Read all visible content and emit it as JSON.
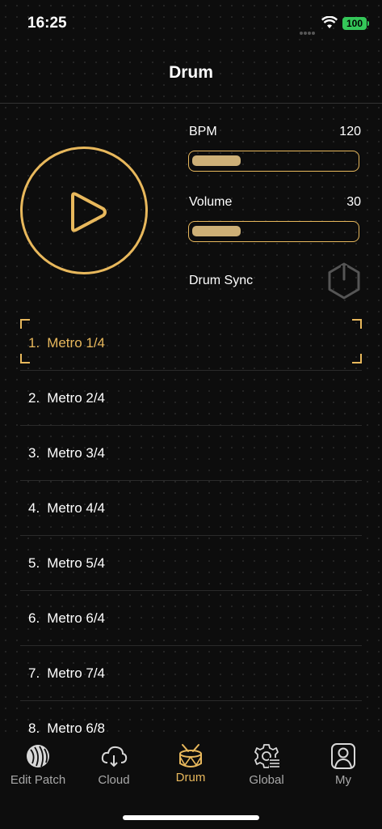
{
  "status": {
    "time": "16:25",
    "battery": "100"
  },
  "nav": {
    "title": "Drum"
  },
  "controls": {
    "bpm_label": "BPM",
    "bpm_value": "120",
    "bpm_fraction": 0.3,
    "volume_label": "Volume",
    "volume_value": "30",
    "volume_fraction": 0.3,
    "sync_label": "Drum Sync"
  },
  "patterns": [
    {
      "number": "1.",
      "name": "Metro 1/4",
      "selected": true
    },
    {
      "number": "2.",
      "name": "Metro 2/4",
      "selected": false
    },
    {
      "number": "3.",
      "name": "Metro 3/4",
      "selected": false
    },
    {
      "number": "4.",
      "name": "Metro 4/4",
      "selected": false
    },
    {
      "number": "5.",
      "name": "Metro 5/4",
      "selected": false
    },
    {
      "number": "6.",
      "name": "Metro 6/4",
      "selected": false
    },
    {
      "number": "7.",
      "name": "Metro 7/4",
      "selected": false
    },
    {
      "number": "8.",
      "name": "Metro 6/8",
      "selected": false
    }
  ],
  "tabs": [
    {
      "label": "Edit Patch",
      "icon": "edit-patch-icon",
      "active": false
    },
    {
      "label": "Cloud",
      "icon": "cloud-download-icon",
      "active": false
    },
    {
      "label": "Drum",
      "icon": "drum-icon",
      "active": true
    },
    {
      "label": "Global",
      "icon": "global-settings-icon",
      "active": false
    },
    {
      "label": "My",
      "icon": "user-icon",
      "active": false
    }
  ],
  "colors": {
    "accent": "#e8b85c",
    "background": "#0d0d0d",
    "inactive": "#a8a8a8"
  }
}
